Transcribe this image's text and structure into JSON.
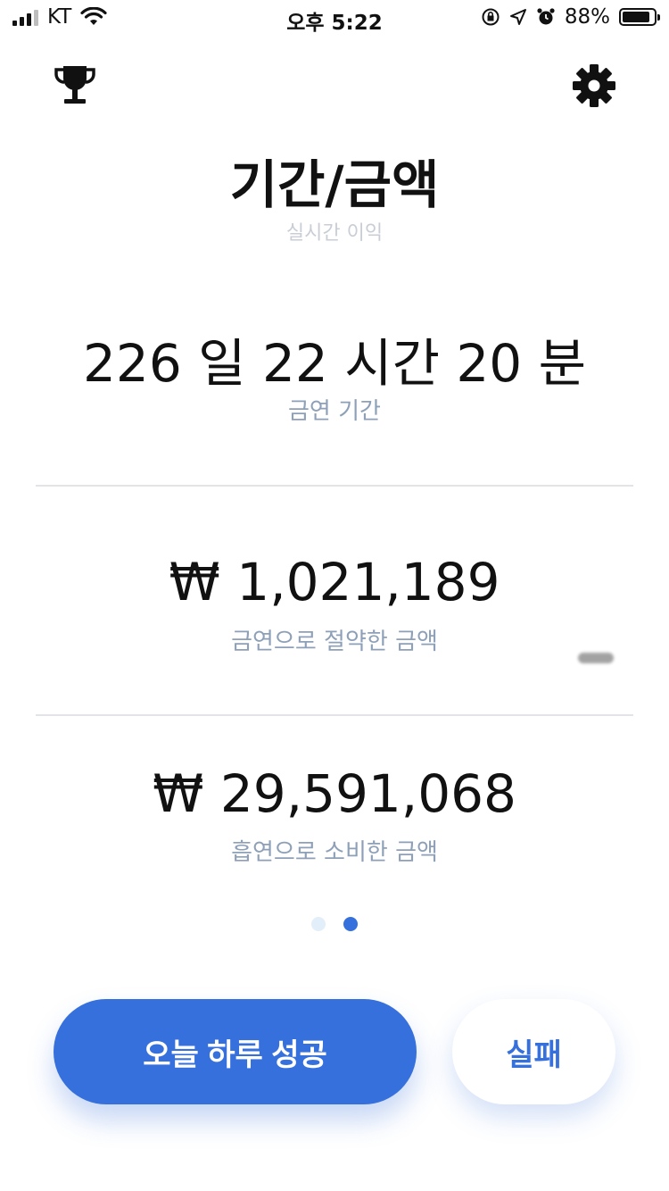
{
  "status_bar": {
    "carrier": "KT",
    "time": "오후 5:22",
    "battery": "88%",
    "battery_level": 0.88
  },
  "header": {
    "left_icon": "trophy-icon",
    "right_icon": "gear-icon",
    "title": "기간/금액",
    "subtitle": "실시간 이익"
  },
  "metrics": [
    {
      "value": "226 일 22 시간 20 분",
      "label": "금연 기간"
    },
    {
      "value": "₩ 1,021,189",
      "label": "금연으로 절약한 금액"
    },
    {
      "value": "₩ 29,591,068",
      "label": "흡연으로 소비한 금액"
    }
  ],
  "pager": {
    "total": 2,
    "active_index": 1
  },
  "actions": {
    "success_label": "오늘 하루 성공",
    "fail_label": "실패"
  },
  "colors": {
    "accent": "#3670dc",
    "label_gray": "#8da0b8",
    "subtitle_gray": "#c9ced6"
  }
}
